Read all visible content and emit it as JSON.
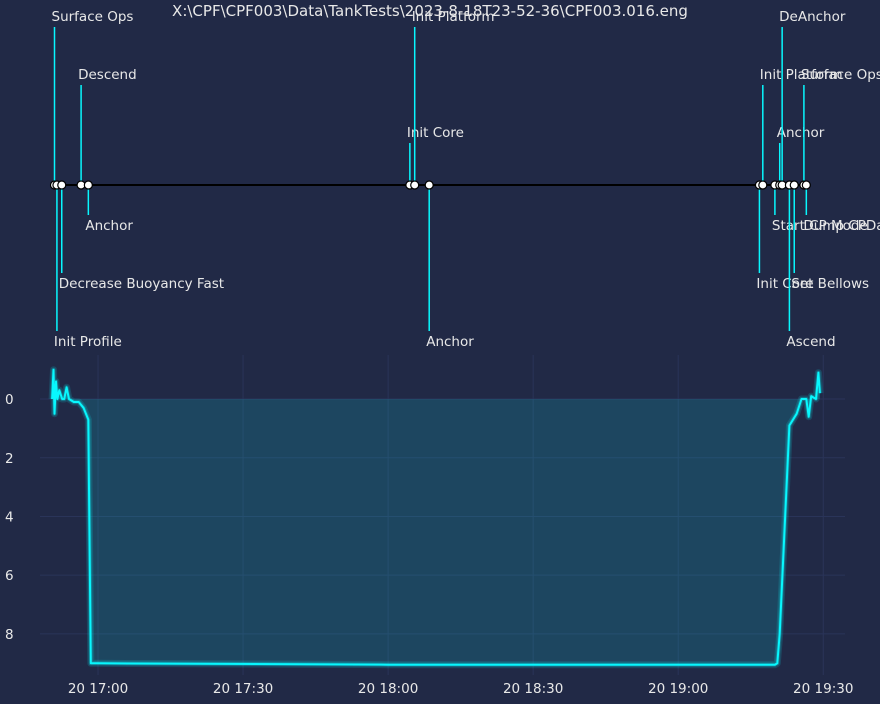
{
  "chart_data": [
    {
      "type": "timeline",
      "title": "X:\\CPF\\CPF003\\Data\\TankTests\\2023-8-18T23-52-36\\CPF003.016.eng",
      "events": [
        {
          "label": "Init Profile",
          "time": "16:51.5"
        },
        {
          "label": "Surface Ops",
          "time": "16:51.0"
        },
        {
          "label": "Decrease Buoyancy Fast",
          "time": "16:52.5"
        },
        {
          "label": "Descend",
          "time": "16:56.5"
        },
        {
          "label": "Anchor",
          "time": "16:58.0"
        },
        {
          "label": "Init Core",
          "time": "18:04.5"
        },
        {
          "label": "Init Platform",
          "time": "18:05.5"
        },
        {
          "label": "Anchor",
          "time": "18:08.5"
        },
        {
          "label": "Init Core",
          "time": "19:16.8"
        },
        {
          "label": "Init Platform",
          "time": "19:17.5"
        },
        {
          "label": "Start CP Mode",
          "time": "19:20.0"
        },
        {
          "label": "Anchor",
          "time": "19:21.0"
        },
        {
          "label": "DeAnchor",
          "time": "19:21.5"
        },
        {
          "label": "Ascend",
          "time": "19:23.0"
        },
        {
          "label": "Set Bellows",
          "time": "19:24.0"
        },
        {
          "label": "Surface Ops",
          "time": "19:26.0"
        },
        {
          "label": "Dump CPData",
          "time": "19:26.5"
        }
      ]
    },
    {
      "type": "line",
      "xlabel": "",
      "ylabel": "",
      "x_ticks": [
        "20 17:00",
        "20 17:30",
        "20 18:00",
        "20 18:30",
        "20 19:00",
        "20 19:30"
      ],
      "y_ticks": [
        "0",
        "2",
        "4",
        "6",
        "8"
      ],
      "xlim": [
        "16:48.0",
        "19:34.5"
      ],
      "ylim": [
        9.4,
        -1.5
      ],
      "y_inverted": true,
      "grid": true,
      "colors": {
        "line": "#08F7FE",
        "fill": "#08F7FE",
        "background": "#212946",
        "grid": "#2A3459",
        "text": "#E8E8E8"
      },
      "series": [
        {
          "x": [
            "16:50.5",
            "16:50.8",
            "16:51.0",
            "16:51.3",
            "16:51.6",
            "16:52.0",
            "16:52.6",
            "16:53.0",
            "16:53.5",
            "16:54.0",
            "16:55.0",
            "16:56.0",
            "16:57.0",
            "16:58.0",
            "16:58.5",
            "17:00.0",
            "18:00.0",
            "19:00.0",
            "19:18.5",
            "19:20.0",
            "19:20.5",
            "19:21.0",
            "19:23.0",
            "19:24.5",
            "19:25.5",
            "19:26.5",
            "19:27.0",
            "19:27.5",
            "19:28.5",
            "19:29.0",
            "19:29.3"
          ],
          "y": [
            0.0,
            -1.0,
            0.5,
            -0.6,
            0.0,
            -0.3,
            0.0,
            0.0,
            -0.4,
            0.0,
            0.1,
            0.1,
            0.3,
            0.7,
            9.0,
            9.0,
            9.05,
            9.05,
            9.05,
            9.05,
            9.0,
            8.0,
            0.9,
            0.5,
            0.0,
            0.0,
            0.6,
            -0.1,
            0.0,
            -0.9,
            -0.2
          ]
        }
      ]
    }
  ]
}
